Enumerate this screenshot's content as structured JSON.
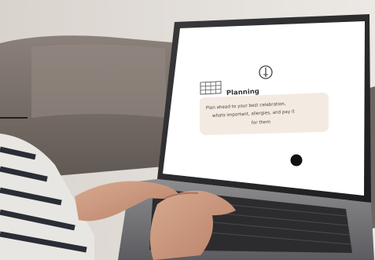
{
  "slide": {
    "heading": "Planning",
    "body_line_1": "Plan ahead to your best celebration,",
    "body_line_2": "whats important, allergies, and pay it",
    "body_line_3": "for them"
  },
  "icons": {
    "top": "pencil-icon",
    "left": "calendar-grid-icon",
    "dot": "black-dot"
  },
  "colors": {
    "wall": "#e9e6e2",
    "sofa": "#7a716b",
    "screen": "#ffffff",
    "card": "#f3ebe2",
    "laptop_frame": "#2b2b2d",
    "keyboard": "#2a2a2c",
    "skin": "#c99a80"
  }
}
